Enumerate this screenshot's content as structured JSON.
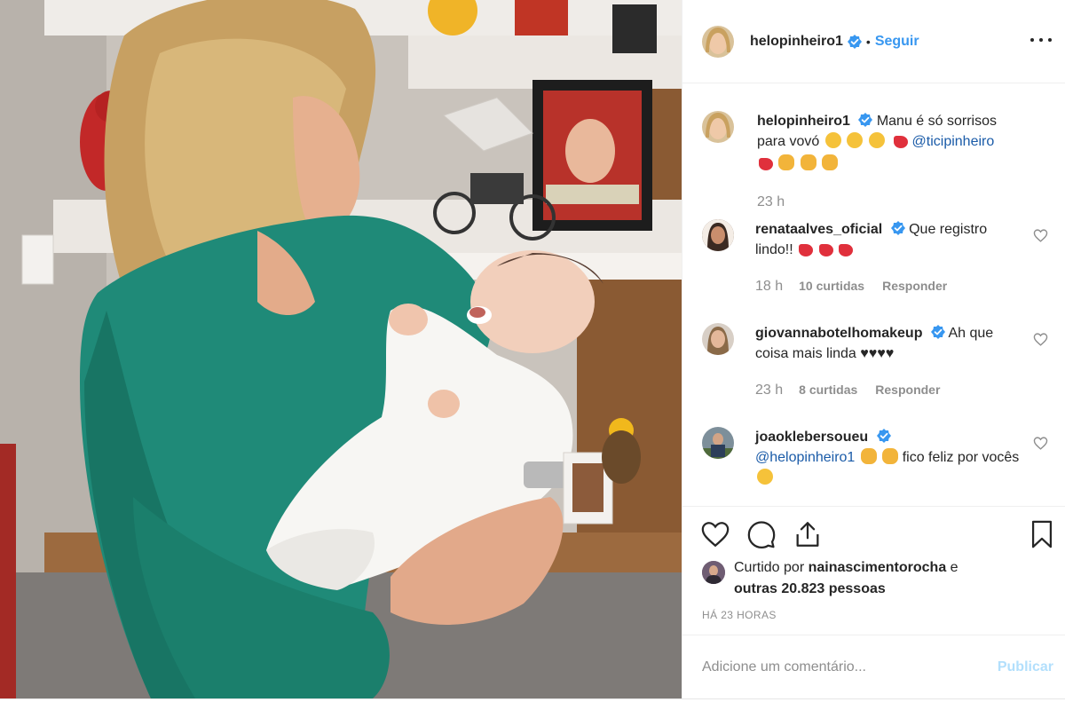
{
  "post": {
    "username": "helopinheiro1",
    "dot": "•",
    "follow_label": "Seguir",
    "more_label": "Mais opções"
  },
  "caption": {
    "username": "helopinheiro1",
    "text": "Manu é só sorrisos para vovó",
    "mention": "@ticipinheiro",
    "time": "23 h"
  },
  "comments": [
    {
      "username": "renataalves_oficial",
      "text": "Que registro lindo!!",
      "time": "18 h",
      "likes": "10 curtidas",
      "reply": "Responder"
    },
    {
      "username": "giovannabotelhomakeup",
      "text": "Ah que coisa mais linda ♥♥♥♥",
      "time": "23 h",
      "likes": "8 curtidas",
      "reply": "Responder"
    },
    {
      "username": "joaoklebersoueu",
      "mention": "@helopinheiro1",
      "text": "fico feliz por vocês"
    }
  ],
  "actions": {
    "like": "heart-icon",
    "comment": "comment-icon",
    "share": "share-icon",
    "save": "bookmark-icon"
  },
  "likes": {
    "prefix": "Curtido por",
    "user": "nainascimentorocha",
    "suffix": "e",
    "others": "outras 20.823 pessoas"
  },
  "timestamp": "HÁ 23 HORAS",
  "add_comment": {
    "placeholder": "Adicione um comentário...",
    "publish_label": "Publicar"
  },
  "colors": {
    "link": "#3897f0",
    "mention": "#1a5ba8",
    "muted": "#8e8e8e",
    "publish_disabled": "#b2dffc",
    "verified": "#3897f0"
  }
}
